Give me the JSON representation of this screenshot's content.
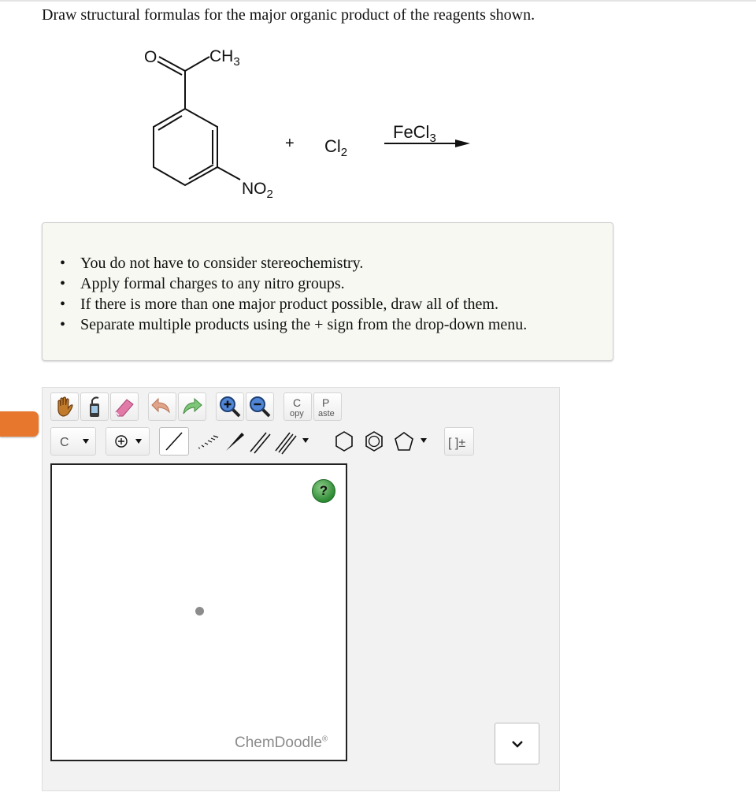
{
  "question": {
    "prompt": "Draw structural formulas for the major organic product of the reagents shown."
  },
  "reaction": {
    "substituent_top": "CH3",
    "carbonyl_oxygen": "O",
    "substituent_meta": "NO2",
    "plus": "+",
    "reagent": "Cl2",
    "catalyst": "FeCl3"
  },
  "instructions": [
    "You do not have to consider stereochemistry.",
    "Apply formal charges to any nitro groups.",
    "If there is more than one major product possible, draw all of them.",
    "Separate multiple products using the + sign from the drop-down menu."
  ],
  "editor": {
    "copy_letter": "C",
    "copy_rest": "opy",
    "paste_letter": "P",
    "paste_rest": "aste",
    "element_selected": "C",
    "charge_symbol": "⊕",
    "bracket_symbol": "[ ]±",
    "help_symbol": "?",
    "brand": "ChemDoodle",
    "brand_mark": "®",
    "icons": [
      "hand-icon",
      "eraser-bottle-icon",
      "eraser-icon",
      "undo-icon",
      "redo-icon",
      "zoom-in-icon",
      "zoom-out-icon"
    ],
    "colors": {
      "accent_tab": "#e7772d",
      "help_green": "#2d8a34"
    }
  }
}
